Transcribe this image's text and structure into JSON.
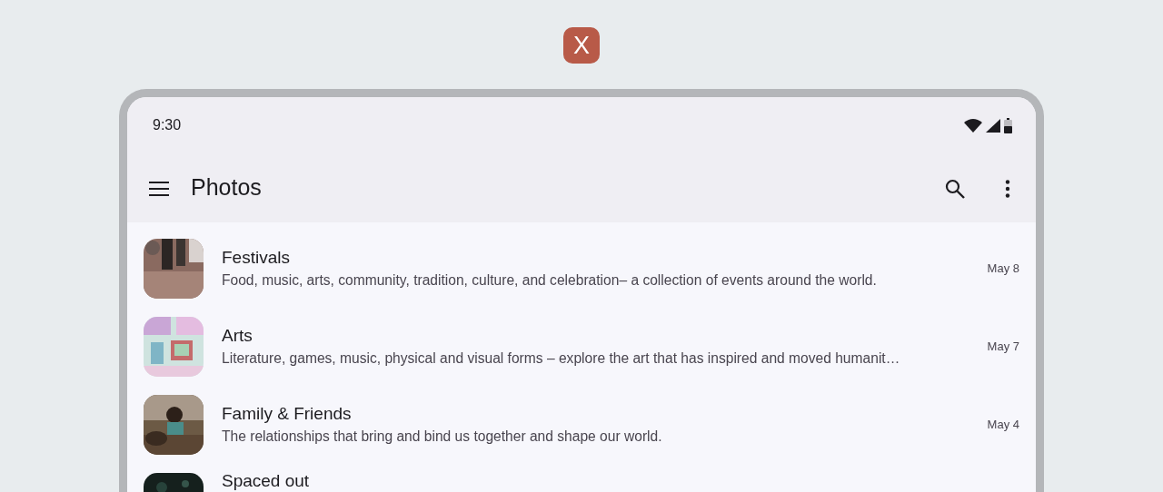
{
  "badge": {
    "text": "X"
  },
  "status_bar": {
    "time": "9:30"
  },
  "app_bar": {
    "title": "Photos"
  },
  "items": [
    {
      "title": "Festivals",
      "description": "Food, music, arts, community, tradition, culture, and celebration– a collection of events around the world.",
      "date": "May 8"
    },
    {
      "title": "Arts",
      "description": "Literature, games, music, physical and visual forms – explore the art that has inspired and moved humanit…",
      "date": "May 7"
    },
    {
      "title": "Family & Friends",
      "description": "The relationships that bring and bind us together and shape our world.",
      "date": "May 4"
    },
    {
      "title": "Spaced out"
    }
  ]
}
